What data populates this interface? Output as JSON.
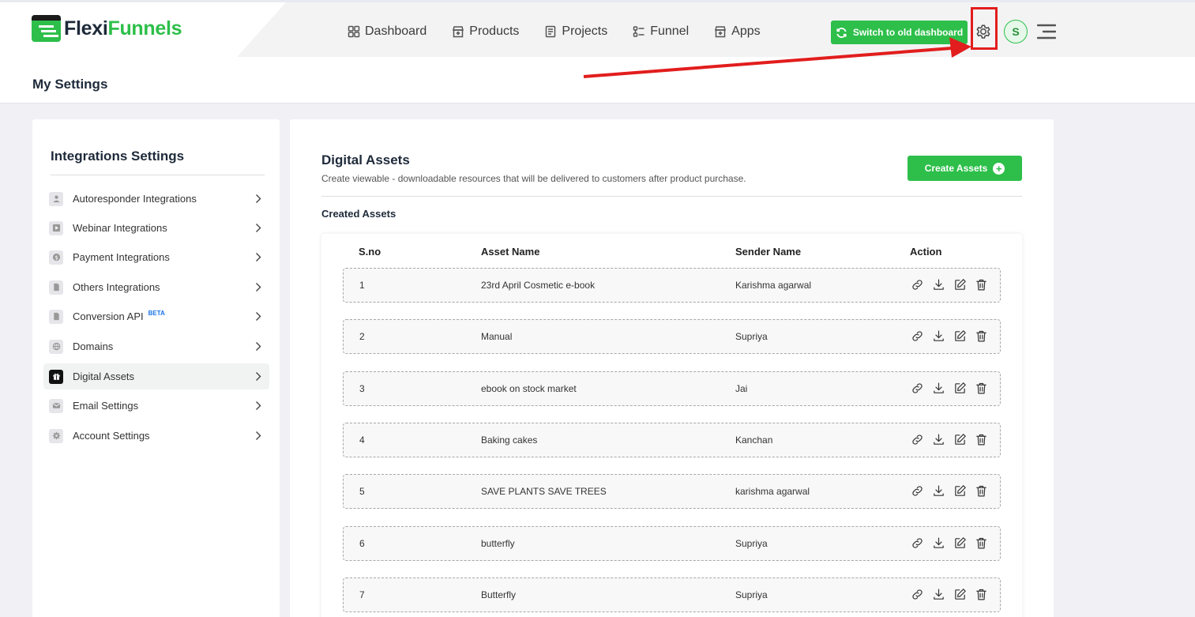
{
  "header": {
    "logo_part1": "Flexi",
    "logo_part2": "Funnels",
    "nav": [
      "Dashboard",
      "Products",
      "Projects",
      "Funnel",
      "Apps"
    ],
    "switch_label": "Switch to old dashboard",
    "avatar_initial": "S",
    "highlight_color": "#e21d1d"
  },
  "page": {
    "title": "My Settings"
  },
  "sidebar": {
    "title": "Integrations Settings",
    "items": [
      {
        "label": "Autoresponder Integrations",
        "icon": "user-icon"
      },
      {
        "label": "Webinar Integrations",
        "icon": "video-icon"
      },
      {
        "label": "Payment Integrations",
        "icon": "dollar-icon"
      },
      {
        "label": "Others Integrations",
        "icon": "document-icon"
      },
      {
        "label": "Conversion API",
        "icon": "document-icon",
        "badge": "BETA"
      },
      {
        "label": "Domains",
        "icon": "globe-icon"
      },
      {
        "label": "Digital Assets",
        "icon": "gift-icon",
        "active": true
      },
      {
        "label": "Email Settings",
        "icon": "mail-icon"
      },
      {
        "label": "Account Settings",
        "icon": "gear-icon"
      }
    ]
  },
  "main": {
    "title": "Digital Assets",
    "description": "Create viewable - downloadable resources that will be delivered to customers after product purchase.",
    "create_label": "Create Assets",
    "section_title": "Created Assets",
    "columns": [
      "S.no",
      "Asset Name",
      "Sender Name",
      "Action"
    ],
    "rows": [
      {
        "sno": "1",
        "asset": "23rd April Cosmetic e-book",
        "sender": "Karishma agarwal"
      },
      {
        "sno": "2",
        "asset": "Manual",
        "sender": "Supriya"
      },
      {
        "sno": "3",
        "asset": "ebook on stock market",
        "sender": "Jai"
      },
      {
        "sno": "4",
        "asset": "Baking cakes",
        "sender": "Kanchan"
      },
      {
        "sno": "5",
        "asset": "SAVE PLANTS SAVE TREES",
        "sender": "karishma agarwal"
      },
      {
        "sno": "6",
        "asset": "butterfly",
        "sender": "Supriya"
      },
      {
        "sno": "7",
        "asset": "Butterfly",
        "sender": "Supriya"
      }
    ]
  },
  "colors": {
    "brand_green": "#2dbf4a",
    "dark_text": "#1e2a3a"
  }
}
